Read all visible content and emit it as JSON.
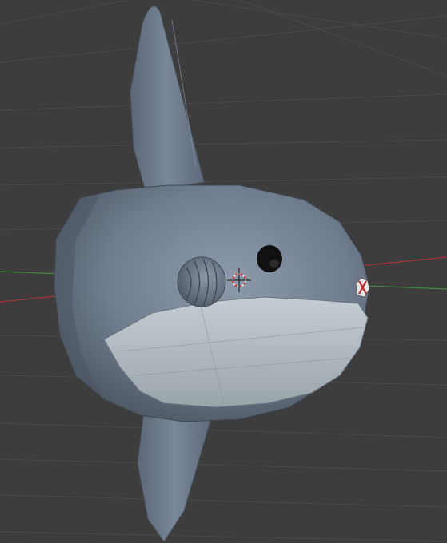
{
  "viewport": {
    "background": "#3d3d3d",
    "grid_color": "#4a4a4a",
    "x_axis_color": "#a33a3a",
    "y_axis_color": "#3f8a3f"
  },
  "model": {
    "body_color": "#6f7d8e",
    "fin_color": "#6a7789",
    "belly_color": "#b6c0c6",
    "eye_color": "#111111",
    "gill_color": "#5d6b7c"
  },
  "overlays": {
    "cursor_icon": "3d-cursor-icon",
    "origin_icon": "object-origin-icon"
  }
}
